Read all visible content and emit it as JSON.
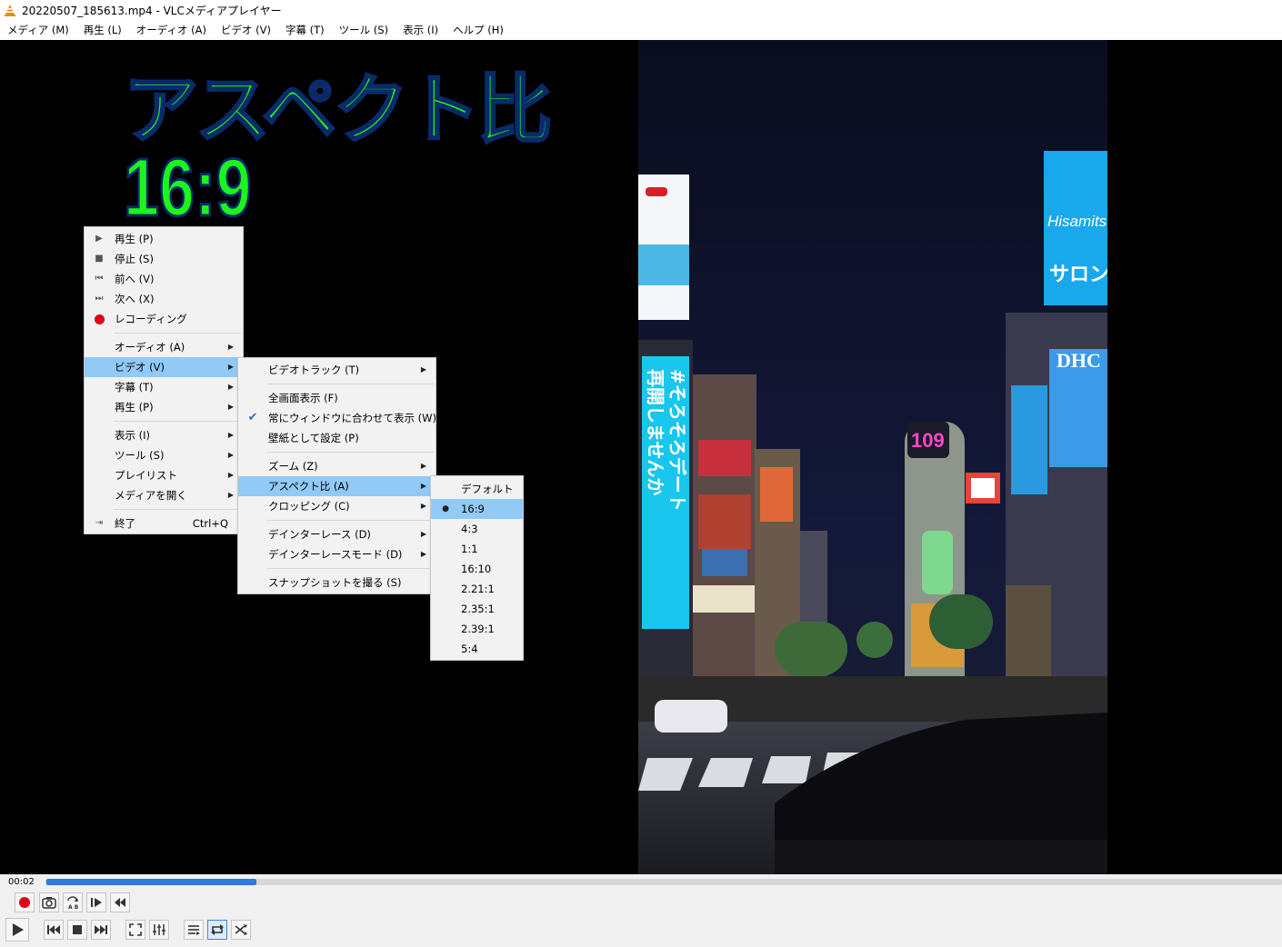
{
  "window": {
    "title": "20220507_185613.mp4 - VLCメディアプレイヤー"
  },
  "menubar": [
    "メディア (M)",
    "再生 (L)",
    "オーディオ (A)",
    "ビデオ (V)",
    "字幕 (T)",
    "ツール (S)",
    "表示 (I)",
    "ヘルプ (H)"
  ],
  "overlay": {
    "heading": "アスペクト比",
    "ratio": "16:9"
  },
  "context_menu": {
    "play": "再生 (P)",
    "stop": "停止 (S)",
    "prev": "前へ (V)",
    "next": "次へ (X)",
    "record": "レコーディング",
    "audio": "オーディオ (A)",
    "video": "ビデオ (V)",
    "subtitle": "字幕 (T)",
    "playback": "再生 (P)",
    "view": "表示 (I)",
    "tools": "ツール (S)",
    "playlist": "プレイリスト",
    "open_media": "メディアを開く",
    "quit": "終了",
    "quit_shortcut": "Ctrl+Q"
  },
  "video_menu": {
    "video_track": "ビデオトラック (T)",
    "fullscreen": "全画面表示 (F)",
    "fit_window": "常にウィンドウに合わせて表示 (W)",
    "wallpaper": "壁紙として設定 (P)",
    "zoom": "ズーム (Z)",
    "aspect": "アスペクト比 (A)",
    "crop": "クロッピング (C)",
    "deinterlace": "デインターレース (D)",
    "deinterlace_mode": "デインターレースモード (D)",
    "snapshot": "スナップショットを撮る (S)"
  },
  "aspect_menu": {
    "options": [
      "デフォルト",
      "16:9",
      "4:3",
      "1:1",
      "16:10",
      "2.21:1",
      "2.35:1",
      "2.39:1",
      "5:4"
    ],
    "selected": "16:9"
  },
  "frame_signs": {
    "sign_109": "109",
    "sign_dhc": "DHC",
    "sign_hisamitsu": "Hisamitsu",
    "sign_salonpas": "サロンパ",
    "billboard": [
      "#そろそろデート",
      "再開しませんか"
    ]
  },
  "controls": {
    "elapsed": "00:02",
    "progress": 0.17
  },
  "colors": {
    "overlay_text": "#1cf51c",
    "highlight": "#91c9f7",
    "seek_fill": "#2f7bd6",
    "record": "#e0001a"
  }
}
